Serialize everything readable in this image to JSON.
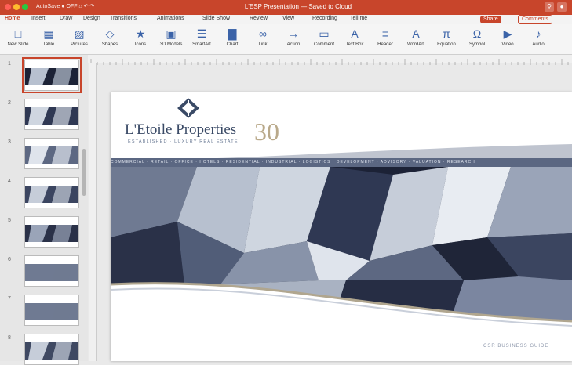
{
  "window": {
    "title": "L'ESP Presentation — Saved to Cloud",
    "left_caption": "AutoSave  ● OFF   ⌂  ↶  ↷",
    "share_label": "Share",
    "comments_label": "Comments"
  },
  "menu": {
    "items": [
      "Home",
      "Insert",
      "Draw",
      "Design",
      "Transitions",
      "Animations",
      "Slide Show",
      "Review",
      "View",
      "Recording",
      "Tell me"
    ]
  },
  "ribbon": {
    "buttons": [
      {
        "label": "New Slide",
        "icon": "new-slide-icon",
        "glyph": "□"
      },
      {
        "label": "Table",
        "icon": "table-icon",
        "glyph": "▦"
      },
      {
        "label": "Pictures",
        "icon": "picture-icon",
        "glyph": "▨"
      },
      {
        "label": "Shapes",
        "icon": "shapes-icon",
        "glyph": "◇"
      },
      {
        "label": "Icons",
        "icon": "icons-icon",
        "glyph": "★"
      },
      {
        "label": "3D Models",
        "icon": "cube-icon",
        "glyph": "▣"
      },
      {
        "label": "SmartArt",
        "icon": "smartart-icon",
        "glyph": "☰"
      },
      {
        "label": "Chart",
        "icon": "chart-icon",
        "glyph": "▇"
      },
      {
        "label": "Link",
        "icon": "link-icon",
        "glyph": "∞"
      },
      {
        "label": "Action",
        "icon": "action-icon",
        "glyph": "→"
      },
      {
        "label": "Comment",
        "icon": "comment-icon",
        "glyph": "▭"
      },
      {
        "label": "Text Box",
        "icon": "textbox-icon",
        "glyph": "A"
      },
      {
        "label": "Header",
        "icon": "header-icon",
        "glyph": "≡"
      },
      {
        "label": "WordArt",
        "icon": "wordart-icon",
        "glyph": "A"
      },
      {
        "label": "Equation",
        "icon": "equation-icon",
        "glyph": "π"
      },
      {
        "label": "Symbol",
        "icon": "symbol-icon",
        "glyph": "Ω"
      },
      {
        "label": "Video",
        "icon": "video-icon",
        "glyph": "▶"
      },
      {
        "label": "Audio",
        "icon": "audio-icon",
        "glyph": "♪"
      }
    ]
  },
  "slides": {
    "numbers": [
      "1",
      "2",
      "3",
      "4",
      "5",
      "6",
      "7",
      "8"
    ],
    "selected_index": 0
  },
  "slide": {
    "brand": "L'Etoile Properties",
    "tagline": "ESTABLISHED · LUXURY REAL ESTATE",
    "anniversary": "30",
    "nav": "COMMERCIAL  ·  RETAIL  ·  OFFICE  ·  HOTELS  ·  RESIDENTIAL  ·  INDUSTRIAL  ·  LOGISTICS  ·  DEVELOPMENT  ·  ADVISORY  ·  VALUATION  ·  RESEARCH",
    "footer": "CSR BUSINESS GUIDE"
  },
  "colors": {
    "accent": "#c8452b",
    "navy": "#3a4a66",
    "gold": "#b9a98a"
  }
}
